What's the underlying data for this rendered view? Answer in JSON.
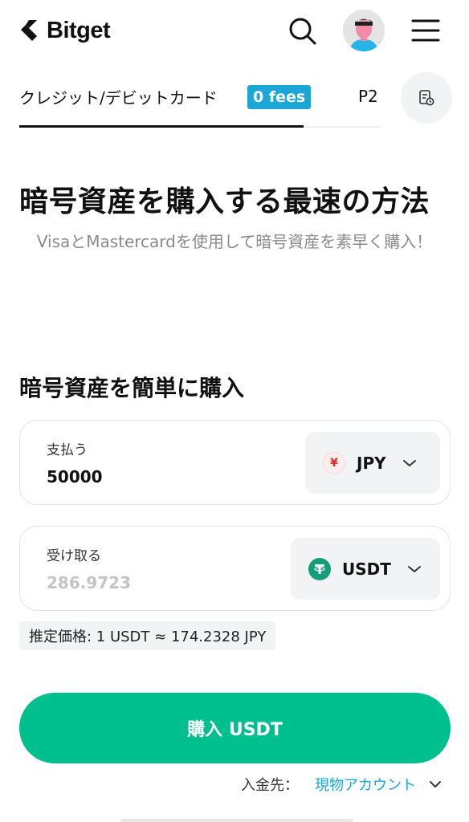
{
  "header": {
    "logo_text": "Bitget",
    "icons": [
      "bitget-logo-icon",
      "search-icon",
      "avatar",
      "menu-icon"
    ]
  },
  "tabs": {
    "card_label": "クレジット/デビットカード",
    "fees_badge": "0 fees",
    "p2p_label": "P2",
    "active_tab": "card_label",
    "history_icon": "order-history-icon"
  },
  "hero": {
    "title": "暗号資産を購入する最速の方法",
    "subtitle": "VisaとMastercardを使用して暗号資産を素早く購入！"
  },
  "buy_section": {
    "title": "暗号資産を簡単に購入",
    "pay": {
      "label": "支払う",
      "value": "50000",
      "currency_symbol": "¥",
      "currency": "JPY"
    },
    "receive": {
      "label": "受け取る",
      "value": "286.9723",
      "currency": "USDT"
    },
    "rate": "推定価格: 1 USDT ≈ 174.2328 JPY",
    "buy_button": "購入 USDT",
    "deposit_label": "入金先：",
    "deposit_value": "現物アカウント"
  },
  "colors": {
    "primary_green": "#00bf8f",
    "badge_blue": "#1aa7d6",
    "usdt_green": "#159d7a",
    "jpy_red": "#e0282d"
  }
}
